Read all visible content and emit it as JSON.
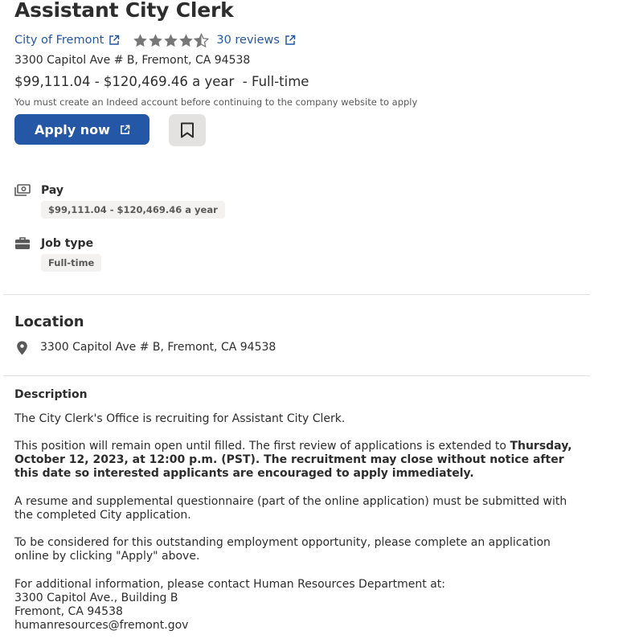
{
  "job": {
    "title": "Assistant City Clerk",
    "company": "City of Fremont",
    "rating": 4.5,
    "reviews_label": "30 reviews",
    "address": "3300 Capitol Ave # B, Fremont, CA 94538",
    "salary_line": "$99,111.04 - $120,469.46 a year  - Full-time",
    "indeed_note": "You must create an Indeed account before continuing to the company website to apply"
  },
  "actions": {
    "apply_label": "Apply now"
  },
  "details": {
    "pay_label": "Pay",
    "pay_value": "$99,111.04 - $120,469.46 a year",
    "job_type_label": "Job type",
    "job_type_value": "Full-time"
  },
  "location": {
    "heading": "Location",
    "address": "3300 Capitol Ave # B, Fremont, CA 94538"
  },
  "description": {
    "heading": "Description",
    "p1": "The City Clerk's Office is recruiting for Assistant City Clerk.",
    "p2_plain": "This position will remain open until filled. The first review of applications is extended to ",
    "p2_bold": "Thursday, October 12, 2023, at 12:00 p.m. (PST). The recruitment may close without notice after this date so interested applicants are encouraged to apply immediately.",
    "p3": "A resume and supplemental questionnaire (part of the online application) must be submitted with the completed City application.",
    "p4": "To be considered for this outstanding employment opportunity, please complete an application online by clicking \"Apply\" above.",
    "p5_line1": "For additional information, please contact Human Resources Department at:",
    "p5_line2": "3300 Capitol Ave., Building B",
    "p5_line3": "Fremont, CA 94538",
    "p5_line4": "humanresources@fremont.gov"
  },
  "colors": {
    "link": "#2557a7",
    "star": "#767676",
    "chip_bg": "#f3f2f1",
    "divider": "#e4e2e0"
  }
}
